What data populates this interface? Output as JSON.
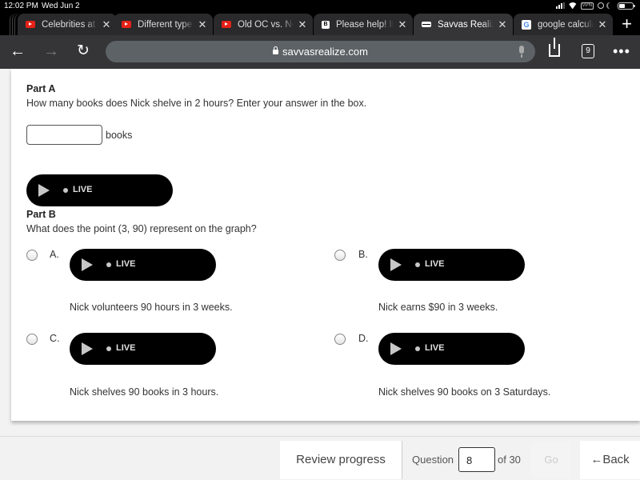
{
  "status_bar": {
    "time": "12:02 PM",
    "date": "Wed Jun 2",
    "vpn_label": "VPN",
    "battery_level": 0.45
  },
  "tabs": [
    {
      "title": "Celebrities at D",
      "favicon": "youtube-icon",
      "active": false
    },
    {
      "title": "Different type c",
      "favicon": "youtube-icon",
      "active": false
    },
    {
      "title": "Old OC vs. New",
      "favicon": "youtube-icon",
      "active": false
    },
    {
      "title": "Please help! It's",
      "favicon": "brainly-icon",
      "active": false
    },
    {
      "title": "Savvas Realize",
      "favicon": "savvas-icon",
      "active": true
    },
    {
      "title": "google calculat",
      "favicon": "google-icon",
      "active": false
    }
  ],
  "toolbar": {
    "url": "savvasrealize.com",
    "tab_count": "9"
  },
  "question": {
    "part_a": {
      "label": "Part A",
      "text": "How many books does Nick shelve in 2 hours? Enter your answer in the box.",
      "answer_value": "",
      "unit": "books"
    },
    "audio_label": "LIVE",
    "part_b": {
      "label": "Part B",
      "text": "What does the point (3, 90) represent on the graph?",
      "choices": [
        {
          "letter": "A.",
          "text": "Nick volunteers 90 hours in 3 weeks.",
          "selected": false
        },
        {
          "letter": "B.",
          "text": "Nick earns $90 in 3 weeks.",
          "selected": false
        },
        {
          "letter": "C.",
          "text": "Nick shelves 90 books in 3 hours.",
          "selected": false
        },
        {
          "letter": "D.",
          "text": "Nick shelves 90 books on 3 Saturdays.",
          "selected": false
        }
      ]
    }
  },
  "nav": {
    "review_label": "Review progress",
    "question_label": "Question",
    "current_question": "8",
    "of_label": "of 30",
    "go_label": "Go",
    "back_label": "Back",
    "back_arrow": "🡐"
  }
}
